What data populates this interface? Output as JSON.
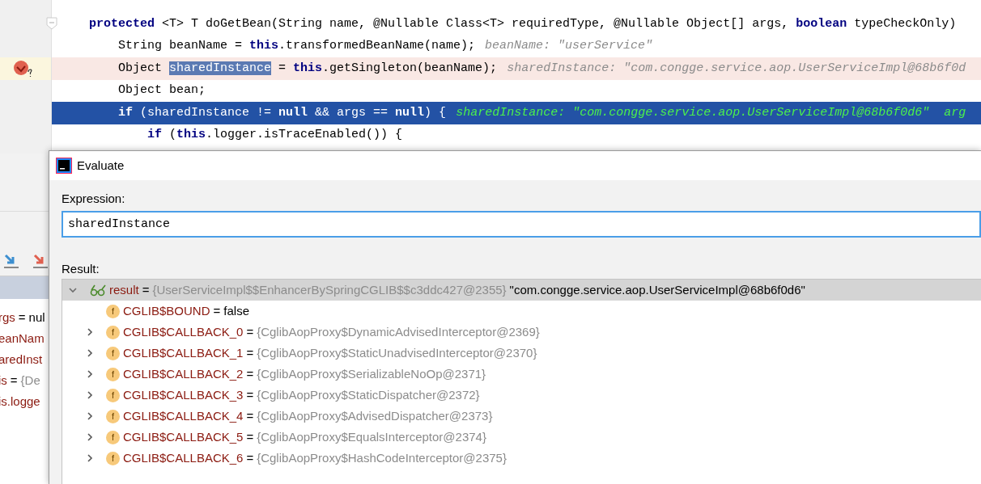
{
  "editor": {
    "lines": [
      {
        "breakpoint": false,
        "current": false,
        "fold": true,
        "tokens": [
          {
            "kind": "keyword",
            "text": "protected"
          },
          {
            "kind": "plain",
            "text": " <T> T doGetBean(String name, @Nullable Class<T> requiredType, @Nullable Object[] args, "
          },
          {
            "kind": "keyword",
            "text": "boolean"
          },
          {
            "kind": "plain",
            "text": " typeCheckOnly)"
          }
        ],
        "children": [
          {
            "breakpoint": false,
            "current": false,
            "fold": false,
            "tokens": [
              {
                "kind": "plain",
                "text": "String beanName = "
              },
              {
                "kind": "keyword",
                "text": "this"
              },
              {
                "kind": "plain",
                "text": ".transformedBeanName(name);"
              }
            ],
            "hint": "beanName: \"userService\""
          },
          {
            "breakpoint": true,
            "current": false,
            "fold": false,
            "tokens": [
              {
                "kind": "plain",
                "text": "Object "
              },
              {
                "kind": "selection",
                "text": "sharedInstance"
              },
              {
                "kind": "plain",
                "text": " = "
              },
              {
                "kind": "keyword",
                "text": "this"
              },
              {
                "kind": "plain",
                "text": ".getSingleton(beanName);"
              }
            ],
            "hint": "sharedInstance: \"com.congge.service.aop.UserServiceImpl@68b6f0d"
          },
          {
            "breakpoint": false,
            "current": false,
            "fold": false,
            "tokens": [
              {
                "kind": "plain",
                "text": "Object bean;"
              }
            ]
          },
          {
            "breakpoint": false,
            "current": true,
            "fold": false,
            "tokens": [
              {
                "kind": "keyword",
                "text": "if"
              },
              {
                "kind": "plain",
                "text": " (sharedInstance != "
              },
              {
                "kind": "keyword",
                "text": "null"
              },
              {
                "kind": "plain",
                "text": " && args == "
              },
              {
                "kind": "keyword",
                "text": "null"
              },
              {
                "kind": "plain",
                "text": ") {"
              }
            ],
            "hint": "sharedInstance: \"com.congge.service.aop.UserServiceImpl@68b6f0d6\"  arg",
            "children": [
              {
                "breakpoint": false,
                "current": false,
                "fold": false,
                "tokens": [
                  {
                    "kind": "keyword",
                    "text": "if"
                  },
                  {
                    "kind": "plain",
                    "text": " ("
                  },
                  {
                    "kind": "keyword",
                    "text": "this"
                  },
                  {
                    "kind": "plain",
                    "text": ".logger.isTraceEnabled()) {"
                  }
                ]
              }
            ]
          }
        ]
      }
    ]
  },
  "variables": [
    {
      "name": "rgs",
      "operator": "=",
      "value": "nul",
      "reference": false
    },
    {
      "name": "eanNam"
    },
    {
      "name": "aredInst"
    },
    {
      "name": "is",
      "operator": "=",
      "value": "{De",
      "reference": true
    },
    {
      "name": "is.logge"
    }
  ],
  "dialog": {
    "title": "Evaluate",
    "expression_label": "Expression:",
    "expression": "sharedInstance",
    "result_label": "Result:",
    "tree": [
      {
        "name": "result",
        "operator": "=",
        "ref": "{UserServiceImpl$$EnhancerBySpringCGLIB$$c3ddc427@2355}",
        "value": "\"com.congge.service.aop.UserServiceImpl@68b6f0d6\"",
        "kind": "watch",
        "selected": true,
        "expanded": true,
        "children": [
          {
            "badge": "f",
            "name": "CGLIB$BOUND",
            "operator": "=",
            "value": "false",
            "reference": false,
            "kind": "field",
            "expandable": false
          },
          {
            "badge": "f",
            "name": "CGLIB$CALLBACK_0",
            "operator": "=",
            "value": "{CglibAopProxy$DynamicAdvisedInterceptor@2369}",
            "reference": true,
            "kind": "field",
            "expandable": true
          },
          {
            "badge": "f",
            "name": "CGLIB$CALLBACK_1",
            "operator": "=",
            "value": "{CglibAopProxy$StaticUnadvisedInterceptor@2370}",
            "reference": true,
            "kind": "field",
            "expandable": true
          },
          {
            "badge": "f",
            "name": "CGLIB$CALLBACK_2",
            "operator": "=",
            "value": "{CglibAopProxy$SerializableNoOp@2371}",
            "reference": true,
            "kind": "field",
            "expandable": true
          },
          {
            "badge": "f",
            "name": "CGLIB$CALLBACK_3",
            "operator": "=",
            "value": "{CglibAopProxy$StaticDispatcher@2372}",
            "reference": true,
            "kind": "field",
            "expandable": true
          },
          {
            "badge": "f",
            "name": "CGLIB$CALLBACK_4",
            "operator": "=",
            "value": "{CglibAopProxy$AdvisedDispatcher@2373}",
            "reference": true,
            "kind": "field",
            "expandable": true
          },
          {
            "badge": "f",
            "name": "CGLIB$CALLBACK_5",
            "operator": "=",
            "value": "{CglibAopProxy$EqualsInterceptor@2374}",
            "reference": true,
            "kind": "field",
            "expandable": true
          },
          {
            "badge": "f",
            "name": "CGLIB$CALLBACK_6",
            "operator": "=",
            "value": "{CglibAopProxy$HashCodeInterceptor@2375}",
            "reference": true,
            "kind": "field",
            "expandable": true
          }
        ]
      }
    ]
  }
}
